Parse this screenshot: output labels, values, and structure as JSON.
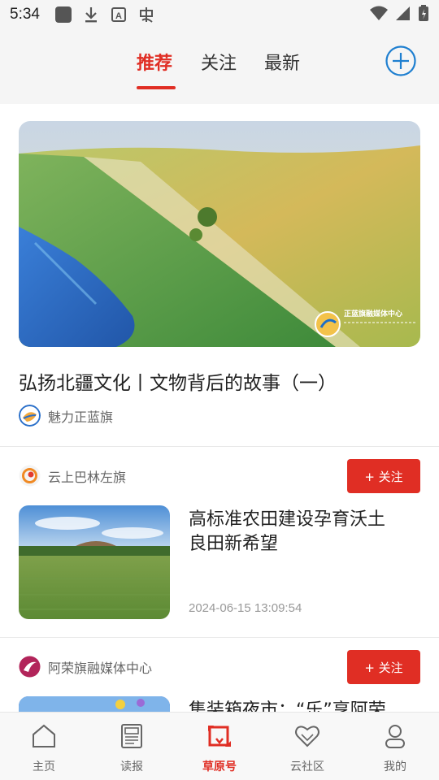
{
  "status_bar": {
    "time": "5:34"
  },
  "top_tabs": [
    {
      "label": "推荐",
      "active": true
    },
    {
      "label": "关注",
      "active": false
    },
    {
      "label": "最新",
      "active": false
    }
  ],
  "hero": {
    "title": "弘扬北疆文化丨文物背后的故事（一）",
    "source": "魅力正蓝旗",
    "watermark": "正蓝旗融媒体中心"
  },
  "feed_items": [
    {
      "source": "云上巴林左旗",
      "follow_label": "+ 关注",
      "title_line1": "高标准农田建设孕育沃土",
      "title_line2": "良田新希望",
      "time": "2024-06-15 13:09:54"
    },
    {
      "source": "阿荣旗融媒体中心",
      "follow_label": "+ 关注",
      "title_line1": "集装箱夜市：“乐”享阿荣"
    }
  ],
  "bottom_nav": [
    {
      "label": "主页",
      "icon": "home-icon",
      "active": false
    },
    {
      "label": "读报",
      "icon": "newspaper-icon",
      "active": false
    },
    {
      "label": "草原号",
      "icon": "grassland-icon",
      "active": true
    },
    {
      "label": "云社区",
      "icon": "community-heart-icon",
      "active": false
    },
    {
      "label": "我的",
      "icon": "person-icon",
      "active": false
    }
  ],
  "colors": {
    "accent": "#e02e24",
    "link_blue": "#1e7fd0",
    "background": "#f5f5f5"
  }
}
